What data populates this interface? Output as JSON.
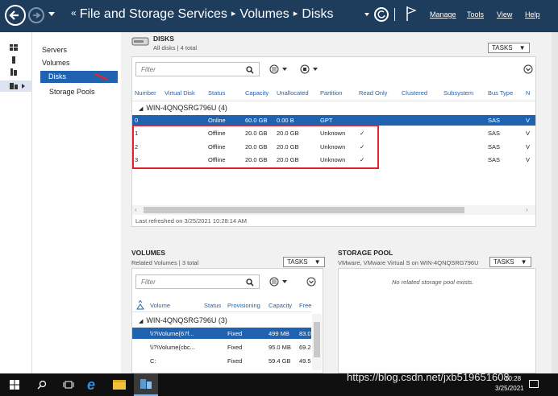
{
  "breadcrumb": {
    "prefix": "«",
    "items": [
      "File and Storage Services",
      "Volumes",
      "Disks"
    ],
    "separator": "▸"
  },
  "menu": {
    "manage": "Manage",
    "tools": "Tools",
    "view": "View",
    "help": "Help"
  },
  "nav": {
    "items": [
      {
        "label": "Servers"
      },
      {
        "label": "Volumes"
      },
      {
        "label": "Disks",
        "selected": true
      },
      {
        "label": "Storage Pools"
      }
    ]
  },
  "disks": {
    "title": "DISKS",
    "subtitle": "All disks | 4 total",
    "tasks_label": "TASKS",
    "filter_placeholder": "Filter",
    "columns": [
      "Number",
      "Virtual Disk",
      "Status",
      "Capacity",
      "Unallocated",
      "Partition",
      "Read Only",
      "Clustered",
      "Subsystem",
      "Bus Type",
      "N"
    ],
    "group": "WIN-4QNQSRG796U (4)",
    "rows": [
      {
        "number": "0",
        "virtual_disk": "",
        "status": "Online",
        "capacity": "60.0 GB",
        "unallocated": "0.00 B",
        "partition": "GPT",
        "read_only": "",
        "clustered": "",
        "subsystem": "",
        "bus_type": "SAS",
        "n": "V"
      },
      {
        "number": "1",
        "virtual_disk": "",
        "status": "Offline",
        "capacity": "20.0 GB",
        "unallocated": "20.0 GB",
        "partition": "Unknown",
        "read_only": "✓",
        "clustered": "",
        "subsystem": "",
        "bus_type": "SAS",
        "n": "V"
      },
      {
        "number": "2",
        "virtual_disk": "",
        "status": "Offline",
        "capacity": "20.0 GB",
        "unallocated": "20.0 GB",
        "partition": "Unknown",
        "read_only": "✓",
        "clustered": "",
        "subsystem": "",
        "bus_type": "SAS",
        "n": "V"
      },
      {
        "number": "3",
        "virtual_disk": "",
        "status": "Offline",
        "capacity": "20.0 GB",
        "unallocated": "20.0 GB",
        "partition": "Unknown",
        "read_only": "✓",
        "clustered": "",
        "subsystem": "",
        "bus_type": "SAS",
        "n": "V"
      }
    ],
    "refreshed": "Last refreshed on 3/25/2021 10:28:14 AM"
  },
  "volumes": {
    "title": "VOLUMES",
    "subtitle": "Related Volumes | 3 total",
    "tasks_label": "TASKS",
    "filter_placeholder": "Filter",
    "columns": [
      "Volume",
      "Status",
      "Provisioning",
      "Capacity",
      "Free"
    ],
    "group": "WIN-4QNQSRG796U (3)",
    "rows": [
      {
        "volume": "\\\\?\\Volume{67f...",
        "status": "",
        "provisioning": "Fixed",
        "capacity": "499 MB",
        "free": "83.0"
      },
      {
        "volume": "\\\\?\\Volume{cbc...",
        "status": "",
        "provisioning": "Fixed",
        "capacity": "95.0 MB",
        "free": "69.2"
      },
      {
        "volume": "C:",
        "status": "",
        "provisioning": "Fixed",
        "capacity": "59.4 GB",
        "free": "49.5"
      }
    ]
  },
  "storage_pool": {
    "title": "STORAGE POOL",
    "subtitle": "VMware, VMware Virtual S on WIN-4QNQSRG796U",
    "tasks_label": "TASKS",
    "empty_message": "No related storage pool exists."
  },
  "taskbar": {
    "time": "10:28",
    "date": "3/25/2021"
  },
  "watermark": "https://blog.csdn.net/jxb519651608",
  "colors": {
    "titlebar": "#1e3c5c",
    "selection": "#1f63b0",
    "highlight_box": "#e0242a",
    "taskbar": "#101010"
  },
  "icons": [
    "back-arrow-icon",
    "forward-arrow-icon",
    "refresh-icon",
    "flag-icon",
    "dashboard-icon",
    "local-server-icon",
    "all-servers-icon",
    "file-storage-icon",
    "search-icon",
    "expand-icon",
    "start-icon",
    "search-icon",
    "task-view-icon",
    "ie-icon",
    "explorer-icon",
    "server-manager-icon"
  ]
}
